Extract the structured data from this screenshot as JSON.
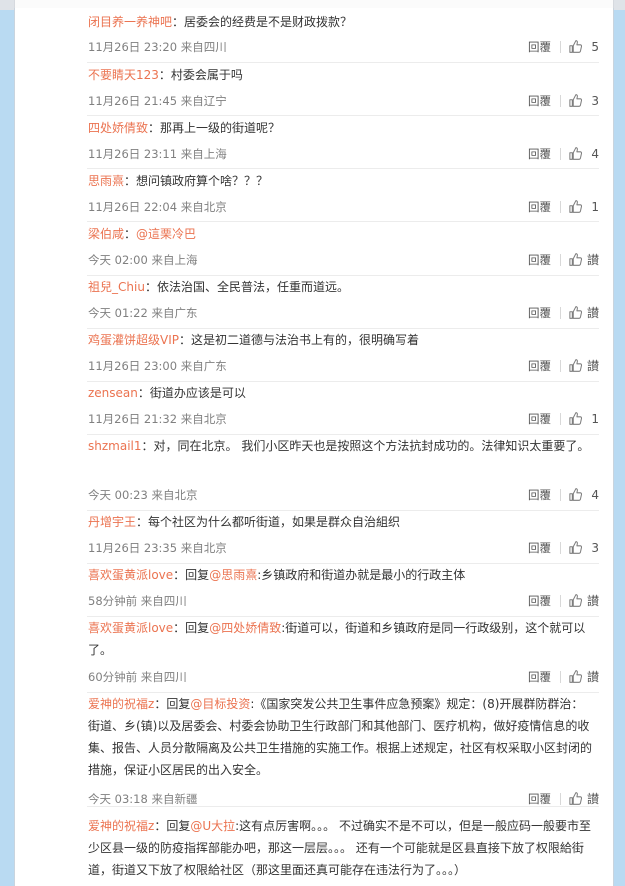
{
  "reply_label": "回覆",
  "comments": [
    {
      "user": "闭目养一养神吧",
      "segments": [
        {
          "t": "：居委会的经费是不是财政拨款？",
          "m": false
        }
      ],
      "time": "11月26日 23:20 来自四川",
      "likes": "5"
    },
    {
      "user": "不要睛天123",
      "segments": [
        {
          "t": "：村委会属于吗",
          "m": false
        }
      ],
      "time": "11月26日 21:45 来自辽宁",
      "likes": "3"
    },
    {
      "user": "四处娇倩致",
      "segments": [
        {
          "t": "：那再上一级的街道呢？",
          "m": false
        }
      ],
      "time": "11月26日 23:11 来自上海",
      "likes": "4"
    },
    {
      "user": "思雨熹",
      "segments": [
        {
          "t": "：想问镇政府算个啥？？？",
          "m": false
        }
      ],
      "time": "11月26日 22:04 来自北京",
      "likes": "1"
    },
    {
      "user": "梁伯咸",
      "segments": [
        {
          "t": "：",
          "m": false
        },
        {
          "t": "@這栗冷巴",
          "m": true
        }
      ],
      "time": "今天 02:00 来自上海",
      "likes": "讃"
    },
    {
      "user": "祖兒_Chiu",
      "segments": [
        {
          "t": "：依法治国、全民普法，任重而道远。",
          "m": false
        }
      ],
      "time": "今天 01:22 来自广东",
      "likes": "讃"
    },
    {
      "user": "鸡蛋灌饼超级VIP",
      "segments": [
        {
          "t": "：这是初二道德与法治书上有的，很明确写着",
          "m": false
        }
      ],
      "time": "11月26日 23:00 来自广东",
      "likes": "讃"
    },
    {
      "user": "zensean",
      "segments": [
        {
          "t": "：街道办应该是可以",
          "m": false
        }
      ],
      "time": "11月26日 21:32 来自北京",
      "likes": "1"
    },
    {
      "user": "shzmail1",
      "segments": [
        {
          "t": "：对，同在北京。 我们小区昨天也是按照这个方法抗封成功的。法律知识太重要了。",
          "m": false
        }
      ],
      "time": "今天 00:23 来自北京",
      "likes": "4"
    },
    {
      "user": "丹增宇王",
      "segments": [
        {
          "t": "：每个社区为什么都听街道，如果是群众自治組织",
          "m": false
        }
      ],
      "time": "11月26日 23:35 来自北京",
      "likes": "3"
    },
    {
      "user": "喜欢蛋黄派love",
      "segments": [
        {
          "t": "：回复",
          "m": false
        },
        {
          "t": "@思雨熹",
          "m": true
        },
        {
          "t": ":乡镇政府和街道办就是最小的行政主体",
          "m": false
        }
      ],
      "time": "58分钟前 来自四川",
      "likes": "讃"
    },
    {
      "user": "喜欢蛋黄派love",
      "segments": [
        {
          "t": "：回复",
          "m": false
        },
        {
          "t": "@四处娇倩致",
          "m": true
        },
        {
          "t": ":街道可以，街道和乡镇政府是同一行政级别，这个就可以了。",
          "m": false
        }
      ],
      "time": "60分钟前 来自四川",
      "likes": "讃"
    },
    {
      "user": "爱神的祝福z",
      "segments": [
        {
          "t": "：回复",
          "m": false
        },
        {
          "t": "@目标投资",
          "m": true
        },
        {
          "t": ":《国家突发公共卫生事件应急预案》规定：(8)开展群防群治：街道、乡(镇)以及居委会、村委会协助卫生行政部门和其他部门、医疗机构，做好疫情信息的收集、报告、人员分散隔离及公共卫生措施的实施工作。根据上述规定，社区有权采取小区封闭的措施，保证小区居民的出入安全。",
          "m": false
        }
      ],
      "time": "今天 03:18 来自新疆",
      "likes": "讃"
    },
    {
      "user": "爱神的祝福z",
      "segments": [
        {
          "t": "：回复",
          "m": false
        },
        {
          "t": "@U大拉",
          "m": true
        },
        {
          "t": ":这有点厉害啊。。。 不过确实不是不可以，但是一般应码一般要市至少区县一级的防疫指挥部能办吧，那这一层层。。。 还有一个可能就是区县直接下放了权限給街道，街道又下放了权限給社区（那这里面还真可能存在违法行为了。。。）",
          "m": false
        }
      ],
      "time": "",
      "likes": ""
    }
  ]
}
